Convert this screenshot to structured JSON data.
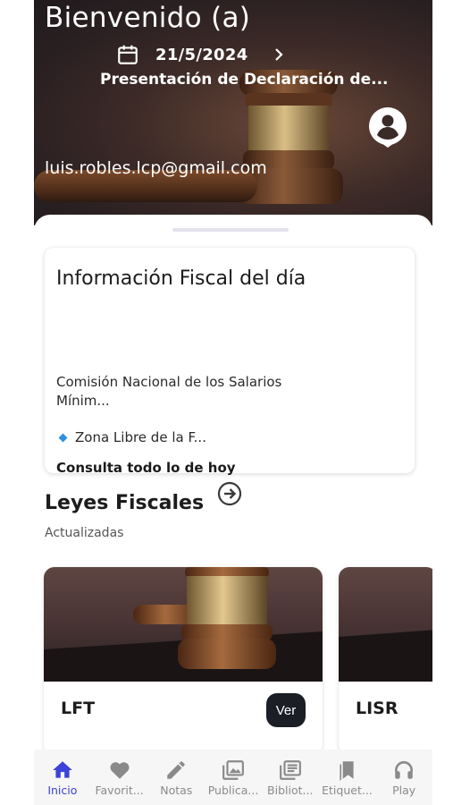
{
  "header": {
    "title": "Bienvenido (a)",
    "date": "21/5/2024",
    "event": "Presentación de Declaración de...",
    "email": "luis.robles.lcp@gmail.com"
  },
  "info_card": {
    "title": "Información Fiscal del día",
    "commission": "Comisión Nacional de los Salarios Mínim...",
    "zone": "Zona Libre de la F...",
    "consulta": "Consulta todo lo de hoy"
  },
  "laws": {
    "title": "Leyes Fiscales",
    "subtitle": "Actualizadas",
    "cards": [
      {
        "name": "LFT",
        "button": "Ver"
      },
      {
        "name": "LISR"
      }
    ]
  },
  "nav": {
    "items": [
      {
        "label": "Inicio",
        "icon": "home-icon",
        "active": true
      },
      {
        "label": "Favorit...",
        "icon": "heart-icon"
      },
      {
        "label": "Notas",
        "icon": "pencil-icon"
      },
      {
        "label": "Publica...",
        "icon": "photo-library-icon"
      },
      {
        "label": "Bibliot...",
        "icon": "library-icon"
      },
      {
        "label": "Etiquet...",
        "icon": "bookmarks-icon"
      },
      {
        "label": "Play",
        "icon": "headphones-icon"
      }
    ]
  },
  "colors": {
    "accent": "#3c43d8",
    "ver_button": "#1b1e24",
    "bullet": "#2f8fe3"
  }
}
